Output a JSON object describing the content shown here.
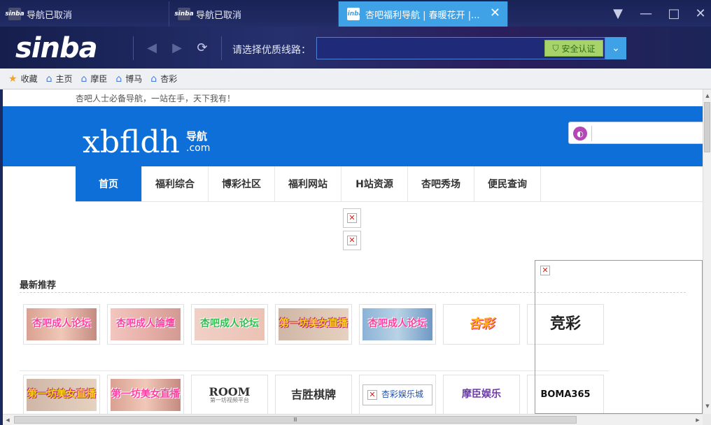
{
  "tabs": [
    {
      "favicon": "sinba",
      "title": "导航已取消"
    },
    {
      "favicon": "sinba",
      "title": "导航已取消"
    },
    {
      "favicon": "sinba",
      "title": "杏吧福利导航 | 春暖花开 |...",
      "active": true
    }
  ],
  "window_controls": {
    "menu": "▼",
    "minimize": "—",
    "maximize": "□",
    "close": "✕"
  },
  "toolbar": {
    "logo": "sinba",
    "back": "◀",
    "forward": "▶",
    "refresh": "⟳",
    "line_label": "请选择优质线路：",
    "address_value": "",
    "cert_label": "安全认证",
    "dropdown": "⌄"
  },
  "bookmarks": [
    {
      "label": "收藏",
      "icon": "star-icon"
    },
    {
      "label": "主页",
      "icon": "home-icon"
    },
    {
      "label": "摩臣",
      "icon": "home-icon"
    },
    {
      "label": "博马",
      "icon": "home-icon"
    },
    {
      "label": "杏彩",
      "icon": "home-icon"
    }
  ],
  "page": {
    "slogan": "杏吧人士必备导航，一站在手，天下我有！",
    "brand": "xbfldh",
    "brand_sub": "导航",
    "brand_com": ".com",
    "search_placeholder": "",
    "nav": [
      "首页",
      "福利综合",
      "博彩社区",
      "福利网站",
      "H站资源",
      "杏吧秀场",
      "便民查询"
    ],
    "section_title": "最新推荐",
    "row1": [
      {
        "text": "杏吧成人论坛",
        "style": "pink"
      },
      {
        "text": "杏吧成人論壇",
        "style": "pink2"
      },
      {
        "text": "杏吧成人论坛",
        "style": "green"
      },
      {
        "text": "第一坊美女直播",
        "style": "yellow"
      },
      {
        "text": "杏吧成人论坛",
        "style": "blue"
      },
      {
        "text": "杏彩",
        "style": "logo-fire"
      },
      {
        "text": "竞彩",
        "style": "jingcai"
      }
    ],
    "row2": [
      {
        "text": "第一坊美女直播",
        "style": "yellow"
      },
      {
        "text": "第一坊美女直播",
        "style": "pink"
      },
      {
        "text": "ROOM",
        "sub": "第一坊视频平台",
        "style": "room"
      },
      {
        "text": "吉胜棋牌",
        "style": "jisheng"
      },
      {
        "text": "杏彩娱乐城",
        "style": "xingcai"
      },
      {
        "text": "摩臣娱乐",
        "style": "moc"
      },
      {
        "text": "BOMA365",
        "style": "boma"
      }
    ]
  },
  "scrollbar": {
    "grip": "Ⅲ"
  }
}
